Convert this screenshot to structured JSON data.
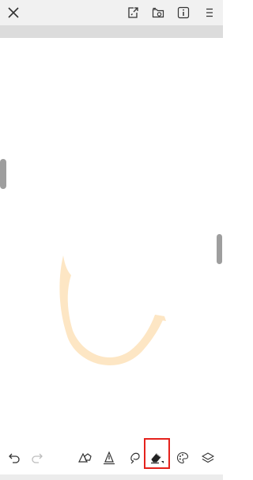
{
  "top_toolbar": {
    "close_icon": "close-icon",
    "export_icon": "export-icon",
    "save_folder_icon": "folder-save-icon",
    "info_icon": "info-icon",
    "menu_icon": "menu-icon"
  },
  "bottom_toolbar": {
    "tools": [
      {
        "icon": "undo-icon"
      },
      {
        "icon": "redo-icon",
        "disabled": true
      },
      {
        "icon": "shapes-icon"
      },
      {
        "icon": "pen-icon"
      },
      {
        "icon": "lasso-icon"
      },
      {
        "icon": "eraser-icon",
        "selected": true
      },
      {
        "icon": "palette-icon"
      },
      {
        "icon": "layers-icon"
      }
    ]
  },
  "canvas": {
    "stroke_color": "#fde6c4"
  },
  "colors": {
    "highlight": "#e5221c",
    "toolbar_bg": "#f1f1f1",
    "icon": "#333333",
    "icon_disabled": "#bdbdbd"
  }
}
